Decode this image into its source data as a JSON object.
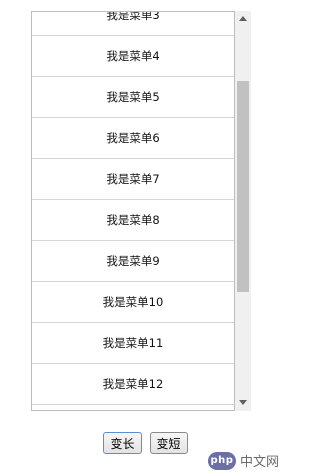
{
  "menu": {
    "items": [
      {
        "label": "我是菜单3"
      },
      {
        "label": "我是菜单4"
      },
      {
        "label": "我是菜单5"
      },
      {
        "label": "我是菜单6"
      },
      {
        "label": "我是菜单7"
      },
      {
        "label": "我是菜单8"
      },
      {
        "label": "我是菜单9"
      },
      {
        "label": "我是菜单10"
      },
      {
        "label": "我是菜单11"
      },
      {
        "label": "我是菜单12"
      },
      {
        "label": ""
      }
    ]
  },
  "buttons": {
    "lengthen_label": "变长",
    "shorten_label": "变短"
  },
  "watermark": {
    "logo": "php",
    "site": "中文网"
  },
  "icons": {
    "scroll_up": "triangle-up-icon",
    "scroll_down": "triangle-down-icon"
  }
}
